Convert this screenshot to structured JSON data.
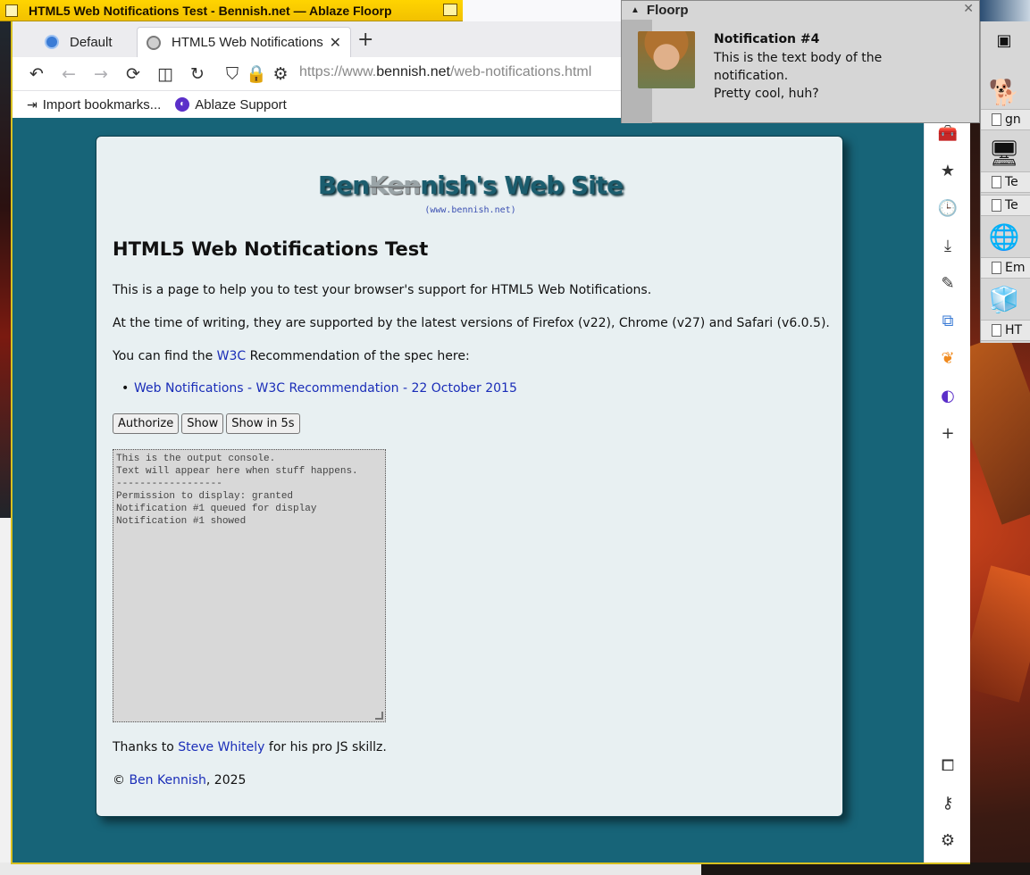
{
  "window": {
    "title": "HTML5 Web Notifications Test - Bennish.net — Ablaze Floorp"
  },
  "tabs": [
    {
      "label": "Default"
    },
    {
      "label": "HTML5 Web Notifications",
      "close": "✕"
    }
  ],
  "new_tab": "+",
  "navbar": {
    "url_prefix": "https://www.",
    "url_host": "bennish.net",
    "url_path": "/web-notifications.html"
  },
  "bookmarks": [
    {
      "label": "Import bookmarks...",
      "icon": "import-icon"
    },
    {
      "label": "Ablaze Support",
      "icon": "ablaze-icon"
    }
  ],
  "page": {
    "site_title_a": "Ben",
    "site_title_k": "Ken",
    "site_title_b": "nish's Web Site",
    "site_sub": "(www.bennish.net)",
    "heading": "HTML5 Web Notifications Test",
    "p1": "This is a page to help you to test your browser's support for HTML5 Web Notifications.",
    "p2": "At the time of writing, they are supported by the latest versions of Firefox (v22), Chrome (v27) and Safari (v6.0.5).",
    "p3_pre": "You can find the ",
    "p3_link": "W3C",
    "p3_post": " Recommendation of the spec here:",
    "bullet_link": "Web Notifications - W3C Recommendation - 22 October 2015",
    "buttons": {
      "authorize": "Authorize",
      "show": "Show",
      "show5": "Show in 5s"
    },
    "console": "This is the output console.\nText will appear here when stuff happens.\n------------------\nPermission to display: granted\nNotification #1 queued for display\nNotification #1 showed",
    "thanks_pre": "Thanks to ",
    "thanks_link": "Steve Whitely",
    "thanks_post": " for his pro JS skillz.",
    "copy_pre": "© ",
    "copy_link": "Ben Kennish",
    "copy_post": ", 2025"
  },
  "notification": {
    "app": "Floorp",
    "close": "✕",
    "title": "Notification #4",
    "body": "This is the text body of the notification.\nPretty cool, huh?"
  },
  "right_panel": {
    "items": [
      "gn",
      "Te",
      "Te",
      "Em",
      "HT"
    ]
  }
}
